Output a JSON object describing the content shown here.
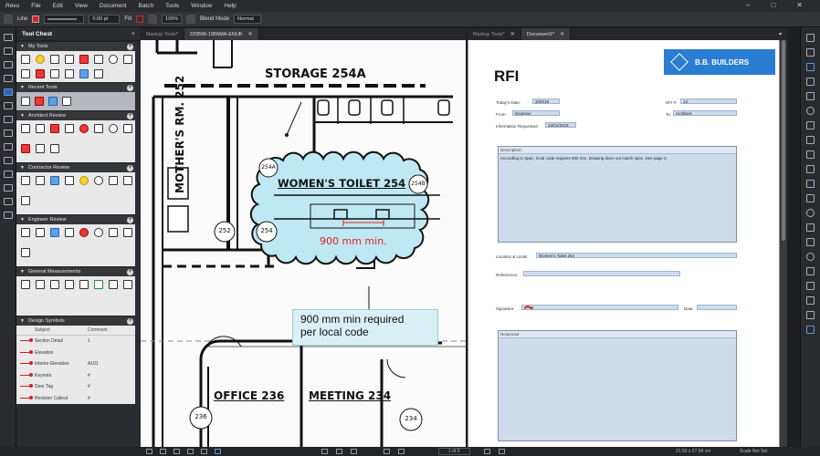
{
  "menubar": {
    "items": [
      "Revu",
      "File",
      "Edit",
      "View",
      "Document",
      "Batch",
      "Tools",
      "Window",
      "Help"
    ]
  },
  "properties": {
    "line_label": "Line",
    "line_color": "#e02020",
    "width_value": "0.00 pt",
    "fill_label": "Fill",
    "opacity_value": "100%",
    "blend_label": "Blend Mode",
    "blend_value": "Normal"
  },
  "toolchest": {
    "title": "Tool Chest",
    "sections": [
      {
        "label": "My Tools"
      },
      {
        "label": "Recent Tools"
      },
      {
        "label": "Architect Review"
      },
      {
        "label": "Contractor Review"
      },
      {
        "label": "Engineer Review"
      },
      {
        "label": "General Measurements"
      },
      {
        "label": "Design Symbols"
      }
    ],
    "symbols_header": {
      "subject": "Subject",
      "comment": "Comment"
    },
    "symbols": [
      {
        "subject": "Section Detail",
        "comment": "1"
      },
      {
        "subject": "Elevation",
        "comment": ""
      },
      {
        "subject": "Interior Elevation",
        "comment": "A101"
      },
      {
        "subject": "Keynote",
        "comment": "#"
      },
      {
        "subject": "Door Tag",
        "comment": "#"
      },
      {
        "subject": "Revision Callout",
        "comment": "#"
      }
    ]
  },
  "tabs_left": [
    {
      "label": "Markup Tools*"
    },
    {
      "label": "220506-1956MA-ENUK"
    }
  ],
  "tabs_right": [
    {
      "label": "Markup Tools*"
    },
    {
      "label": "Document1*"
    }
  ],
  "drawing": {
    "storage": "STORAGE  254A",
    "mothers": "MOTHER'S RM.  252",
    "womens": "WOMEN'S TOILET  254",
    "dim_text": "900 mm min.",
    "tag_252": "252",
    "tag_254": "254",
    "tag_254a": "254A",
    "tag_254b": "254B",
    "tag_236": "236",
    "tag_234": "234",
    "callout_line1": "900 mm min required",
    "callout_line2": "per local code",
    "office": "OFFICE  236",
    "meeting": "MEETING  234"
  },
  "document": {
    "brand": "B.B. BUILDERS",
    "title": "RFI",
    "todays_date_label": "Today's Date:",
    "todays_date": "3/20/18",
    "rfi_label": "RFI #:",
    "rfi_no": "14",
    "from_label": "From:",
    "from": "Engineer",
    "to_label": "To:",
    "to": "Architect",
    "info_req_label": "Information Requested:",
    "info_req": "24/01/2018",
    "description_label": "Description:",
    "description": "According to Spec, local code requires 900 mm. Drawing does not match spec. See page 2.",
    "location_label": "Location & Limits:",
    "location": "Women's Toilet 254",
    "references_label": "References:",
    "signature_label": "Signature:",
    "date_label": "Date:",
    "response_label": "Response:"
  },
  "status": {
    "page": "1 of 2",
    "dims": "21.59 x 27.94 cm",
    "scale": "Scale Not Set"
  },
  "colors": {
    "cloud_fill": "#bfe8f5",
    "cloud_stroke": "#111111",
    "markup_red": "#e02020",
    "brand_blue": "#2a7dd2",
    "accent_orange": "#f08a1e"
  }
}
